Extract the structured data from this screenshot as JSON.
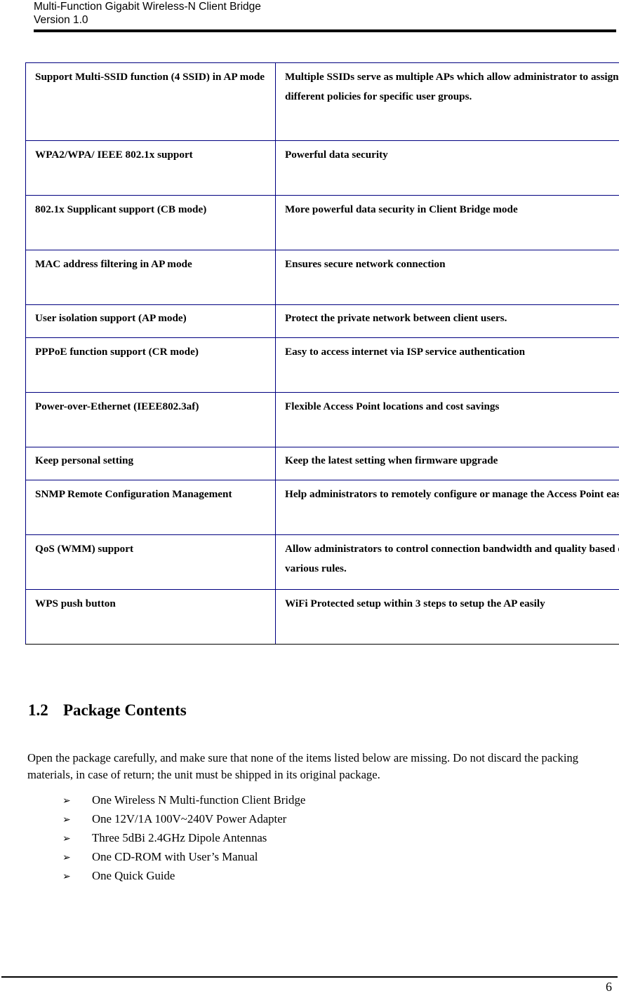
{
  "header": {
    "title": "Multi-Function Gigabit Wireless-N Client Bridge",
    "version": "Version 1.0"
  },
  "feature_table": {
    "rows": [
      {
        "feature": "Support Multi-SSID function (4 SSID) in AP mode",
        "benefit": "Multiple SSIDs serve as multiple APs which allow administrator to assign different policies for specific user groups."
      },
      {
        "feature": "WPA2/WPA/ IEEE 802.1x support",
        "benefit": "Powerful data security"
      },
      {
        "feature": "802.1x Supplicant support (CB mode)",
        "benefit": "More powerful data security in Client Bridge mode"
      },
      {
        "feature": "MAC address filtering in AP mode",
        "benefit": "Ensures secure network connection"
      },
      {
        "feature": "User isolation support (AP mode)",
        "benefit": "Protect the private network between client users."
      },
      {
        "feature": "PPPoE function support (CR mode)",
        "benefit": "Easy to access internet via ISP service authentication"
      },
      {
        "feature": "Power-over-Ethernet (IEEE802.3af)",
        "benefit": "Flexible Access Point locations and cost savings"
      },
      {
        "feature": "Keep personal setting",
        "benefit": "Keep the latest setting when firmware upgrade"
      },
      {
        "feature": "SNMP Remote Configuration Management",
        "benefit": "Help administrators to remotely configure or manage the Access Point easily."
      },
      {
        "feature": "QoS (WMM) support",
        "benefit": "Allow administrators to control connection bandwidth and quality based on various rules."
      },
      {
        "feature": "WPS push button",
        "benefit": "WiFi Protected setup within 3 steps to setup the AP easily"
      }
    ]
  },
  "section": {
    "number": "1.2",
    "title": "Package Contents",
    "intro": "Open the package carefully, and make sure that none of the items listed below are missing. Do not discard the packing materials, in case of return; the unit must be shipped in its original package."
  },
  "package_list": {
    "marker": "➢",
    "items": [
      "One Wireless N Multi-function Client Bridge",
      "One 12V/1A 100V~240V Power Adapter",
      "Three 5dBi 2.4GHz Dipole Antennas",
      "One CD-ROM with User’s Manual",
      "One Quick Guide"
    ]
  },
  "footer": {
    "page_number": "6"
  },
  "colors": {
    "table_border": "#000080",
    "text": "#000000",
    "rule": "#000000"
  }
}
